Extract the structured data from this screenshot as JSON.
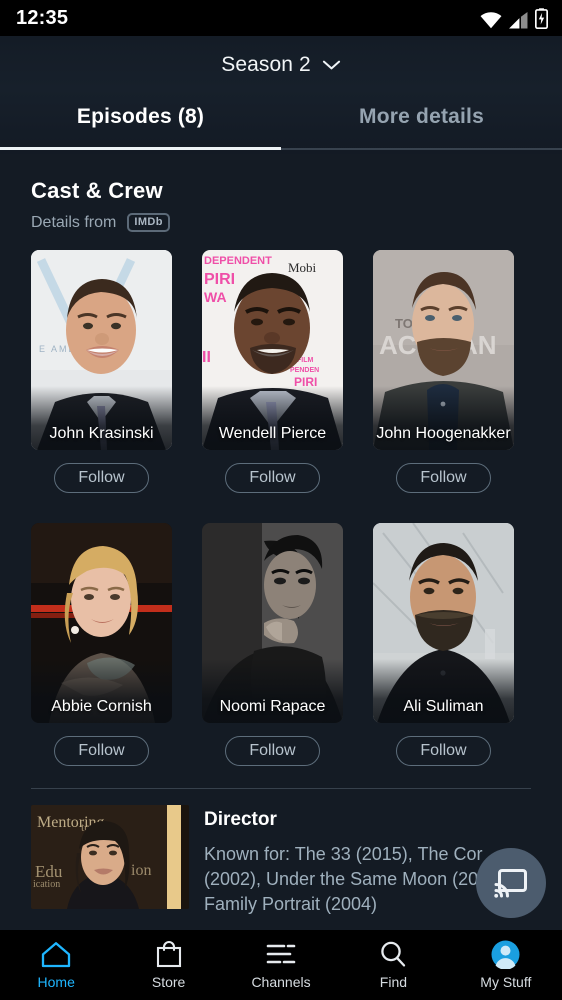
{
  "status_bar": {
    "time": "12:35",
    "icons": [
      "wifi-icon",
      "cellular-signal-icon",
      "battery-charging-icon"
    ]
  },
  "header": {
    "season_selector": {
      "label": "Season 2",
      "icon": "chevron-down-icon"
    },
    "tabs": [
      {
        "label": "Episodes (8)",
        "active": true
      },
      {
        "label": "More details",
        "active": false
      }
    ]
  },
  "cast_section": {
    "title": "Cast & Crew",
    "details_from_label": "Details from",
    "source_badge": "IMDb",
    "follow_label": "Follow",
    "members": [
      {
        "name": "John Krasinski",
        "follow": "Follow"
      },
      {
        "name": "Wendell Pierce",
        "follow": "Follow"
      },
      {
        "name": "John Hoogenakker",
        "follow": "Follow"
      },
      {
        "name": "Abbie Cornish",
        "follow": "Follow"
      },
      {
        "name": "Noomi Rapace",
        "follow": "Follow"
      },
      {
        "name": "Ali Suliman",
        "follow": "Follow"
      }
    ]
  },
  "director_section": {
    "role": "Director",
    "known_for": "Known for: The 33 (2015), The Cor\n(2002), Under the Same Moon (200\nFamily Portrait (2004)"
  },
  "cast_button": {
    "icon": "chromecast-icon"
  },
  "bottom_nav": {
    "items": [
      {
        "label": "Home",
        "icon": "home-icon",
        "active": true
      },
      {
        "label": "Store",
        "icon": "shopping-bag-icon",
        "active": false
      },
      {
        "label": "Channels",
        "icon": "channels-list-icon",
        "active": false
      },
      {
        "label": "Find",
        "icon": "search-icon",
        "active": false
      },
      {
        "label": "My Stuff",
        "icon": "account-avatar-icon",
        "active": false
      }
    ]
  },
  "colors": {
    "background": "#141b24",
    "status_bar_bg": "#000000",
    "accent": "#1fb6ff",
    "tab_active_text": "#ffffff",
    "tab_inactive_text": "#95a3b0",
    "follow_border": "#5d6d7b",
    "fab_bg": "#4c5c6e"
  }
}
